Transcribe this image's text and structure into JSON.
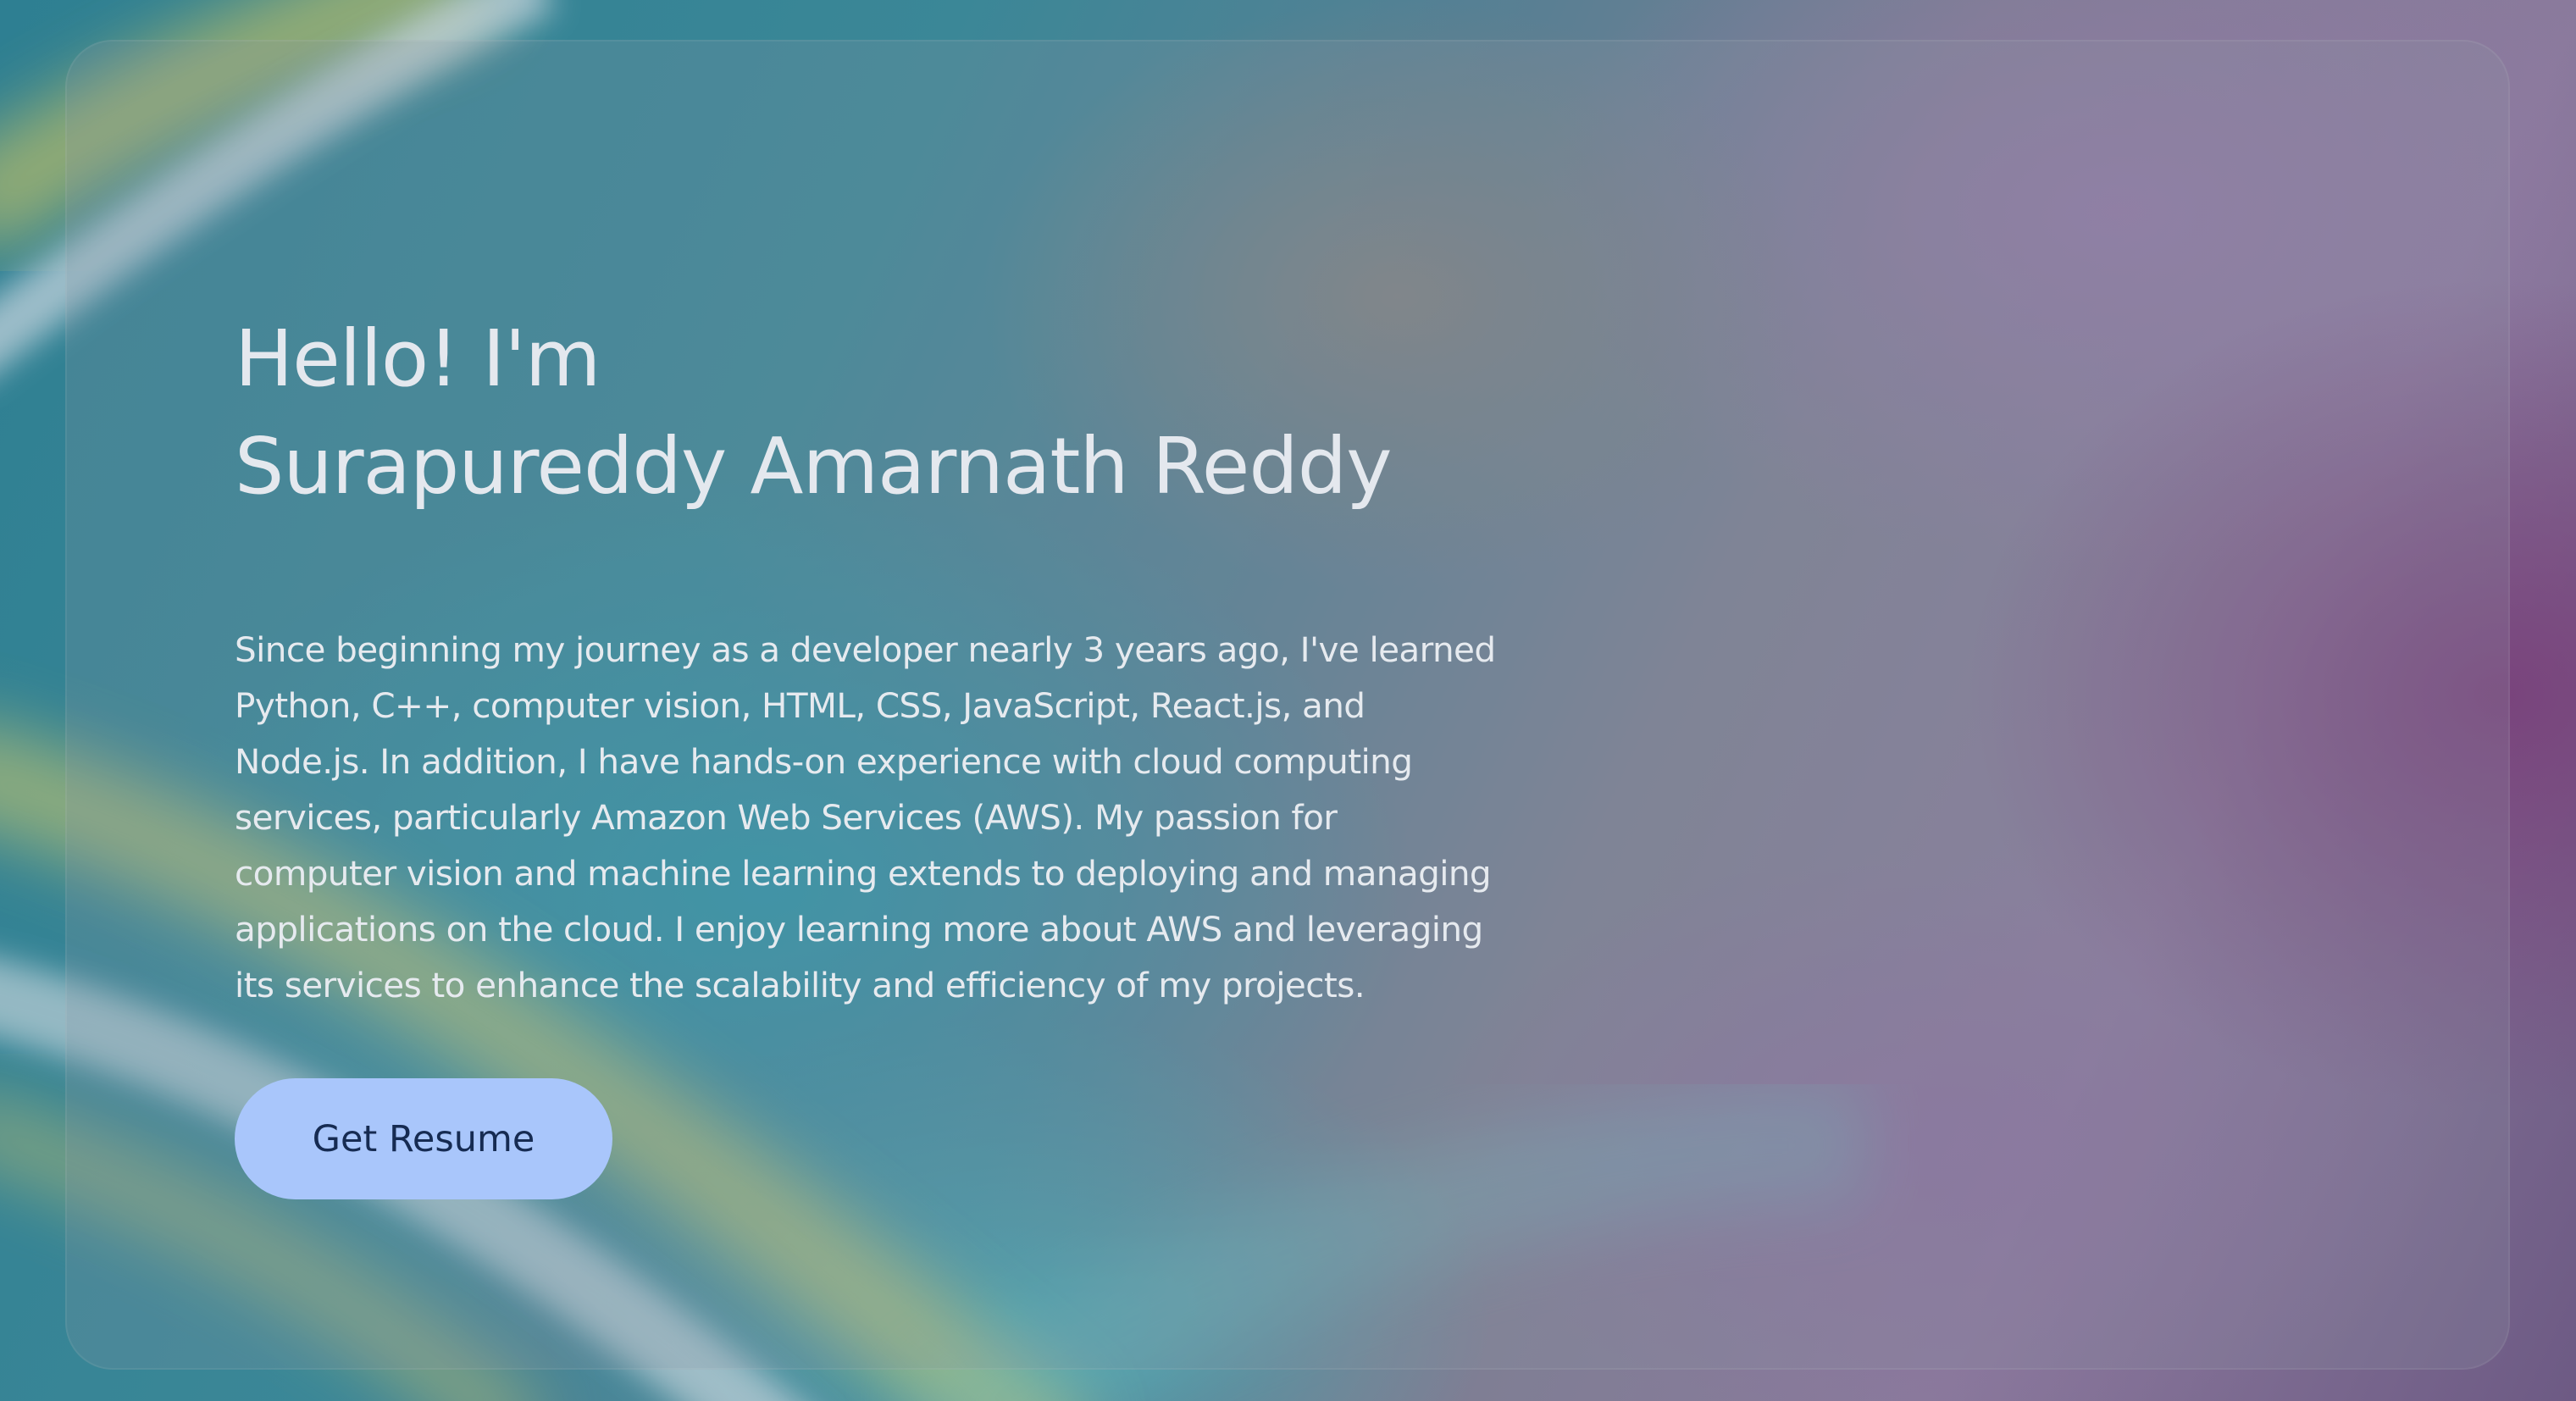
{
  "hero": {
    "greeting": "Hello! I'm",
    "name": "Surapureddy Amarnath Reddy",
    "bio": "Since beginning my journey as a developer nearly 3 years ago, I've learned Python, C++, computer vision, HTML, CSS, JavaScript, React.js, and Node.js. In addition, I have hands-on experience with cloud computing services, particularly Amazon Web Services (AWS). My passion for computer vision and machine learning extends to deploying and managing applications on the cloud. I enjoy learning more about AWS and leveraging its services to enhance the scalability and efficiency of my projects.",
    "resume_button_label": "Get Resume"
  },
  "colors": {
    "heading_text": "#e4e8ee",
    "button_background": "#a9c6fb",
    "button_text": "#162b52"
  }
}
